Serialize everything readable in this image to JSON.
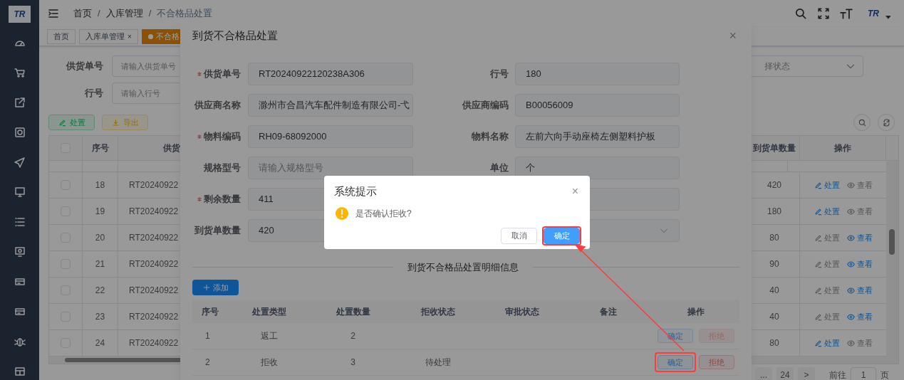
{
  "sidebar": {
    "logo": "TR"
  },
  "header": {
    "breadcrumb": [
      {
        "kind": "link",
        "text": "首页"
      },
      {
        "kind": "separator",
        "text": "/"
      },
      {
        "kind": "link",
        "text": "入库管理"
      },
      {
        "kind": "separator",
        "text": "/"
      },
      {
        "kind": "current",
        "text": "不合格品处置"
      }
    ],
    "avatar": "TR"
  },
  "tags": [
    {
      "label": "首页",
      "selected": false
    },
    {
      "label": "入库单管理",
      "close": "×",
      "selected": false
    },
    {
      "label": "不合格",
      "selected": true
    }
  ],
  "search": {
    "fields": [
      {
        "label": "供货单号",
        "placeholder": "请输入供货单号"
      },
      {
        "label": "行号",
        "placeholder": "请输入行号"
      }
    ],
    "status_select": {
      "placeholder": "择状态"
    }
  },
  "toolbar": [
    {
      "label": "处置",
      "kind": "edit"
    },
    {
      "label": "导出",
      "kind": "export"
    }
  ],
  "table": {
    "select_all_checked": false,
    "columns": [
      "序号",
      "供货",
      "到货单数量",
      "操作"
    ],
    "rows": [
      {
        "checked": false,
        "index": "18",
        "supply_no": "RT20240922",
        "qty": "420",
        "actions": [
          {
            "label": "处置",
            "kind": "edit",
            "enabled": true
          },
          {
            "label": "查看",
            "kind": "view",
            "enabled": false
          }
        ]
      },
      {
        "checked": false,
        "index": "19",
        "supply_no": "RT20240922",
        "qty": "180",
        "actions": [
          {
            "label": "处置",
            "kind": "edit",
            "enabled": true
          },
          {
            "label": "查看",
            "kind": "view",
            "enabled": false
          }
        ]
      },
      {
        "checked": false,
        "index": "20",
        "supply_no": "RT20240922",
        "qty": "80",
        "actions": [
          {
            "label": "处置",
            "kind": "edit",
            "enabled": false
          },
          {
            "label": "查看",
            "kind": "view",
            "enabled": true
          }
        ]
      },
      {
        "checked": false,
        "index": "21",
        "supply_no": "RT20240922",
        "qty": "90",
        "actions": [
          {
            "label": "处置",
            "kind": "edit",
            "enabled": false
          },
          {
            "label": "查看",
            "kind": "view",
            "enabled": true
          }
        ]
      },
      {
        "checked": false,
        "index": "22",
        "supply_no": "RT20240922",
        "qty": "40",
        "actions": [
          {
            "label": "处置",
            "kind": "edit",
            "enabled": false
          },
          {
            "label": "查看",
            "kind": "view",
            "enabled": true
          }
        ]
      },
      {
        "checked": false,
        "index": "23",
        "supply_no": "RT20240922",
        "qty": "40",
        "actions": [
          {
            "label": "处置",
            "kind": "edit",
            "enabled": false
          },
          {
            "label": "查看",
            "kind": "view",
            "enabled": true
          }
        ]
      },
      {
        "checked": false,
        "index": "24",
        "supply_no": "RT20240922",
        "qty": "80",
        "actions": [
          {
            "label": "处置",
            "kind": "edit",
            "enabled": true
          },
          {
            "label": "查看",
            "kind": "view",
            "enabled": false
          }
        ]
      }
    ]
  },
  "pagination": {
    "pages": [
      "...",
      "24",
      ">"
    ],
    "goto_label": "前往",
    "page": "1",
    "unit": "页"
  },
  "dialog": {
    "title": "到货不合格品处置",
    "close": "×",
    "fields": [
      {
        "kind": "input",
        "label": "供货单号",
        "required": true,
        "value": "RT20240922120238A306"
      },
      {
        "kind": "input",
        "label": "行号",
        "required": false,
        "value": "180"
      },
      {
        "kind": "input",
        "label": "供应商名称",
        "required": false,
        "value": "滁州市合昌汽车配件制造有限公司-弋"
      },
      {
        "kind": "input",
        "label": "供应商编码",
        "required": false,
        "value": "B00056009"
      },
      {
        "kind": "input",
        "label": "物料编码",
        "required": true,
        "value": "RH09-68092000"
      },
      {
        "kind": "input",
        "label": "物料名称",
        "required": false,
        "value": "左前六向手动座椅左侧塑料护板"
      },
      {
        "kind": "input",
        "label": "规格型号",
        "required": false,
        "placeholder": "请输入规格型号"
      },
      {
        "kind": "input",
        "label": "单位",
        "required": false,
        "value": "个"
      },
      {
        "kind": "input",
        "label": "剩余数量",
        "required": true,
        "value": "411"
      },
      {
        "kind": "input",
        "required": false
      },
      {
        "kind": "input",
        "label": "到货单数量",
        "required": false,
        "value": "420"
      },
      {
        "kind": "select",
        "required": false
      }
    ],
    "section_title": "到货不合格品处置明细信息",
    "add_button": "添加",
    "detail_table": {
      "columns": [
        "序号",
        "处置类型",
        "处置数量",
        "拒收状态",
        "审批状态",
        "备注",
        "操作"
      ],
      "rows": [
        {
          "index": "1",
          "type": "返工",
          "qty": "2",
          "actions": [
            {
              "label": "确定",
              "kind": "confirm",
              "disabled": true,
              "highlighted": false
            },
            {
              "label": "拒绝",
              "kind": "reject",
              "disabled": true,
              "highlighted": false
            }
          ]
        },
        {
          "index": "2",
          "type": "拒收",
          "qty": "3",
          "reject_status": "待处理",
          "actions": [
            {
              "label": "确定",
              "kind": "confirm",
              "disabled": false,
              "highlighted": true
            },
            {
              "label": "拒绝",
              "kind": "reject",
              "disabled": false,
              "highlighted": false
            }
          ]
        }
      ]
    }
  },
  "message_box": {
    "title": "系统提示",
    "close": "×",
    "message": "是否确认拒收?",
    "buttons": [
      {
        "label": "取消",
        "kind": "cancel",
        "highlighted": false
      },
      {
        "label": "确定",
        "kind": "primary",
        "highlighted": true
      }
    ]
  }
}
